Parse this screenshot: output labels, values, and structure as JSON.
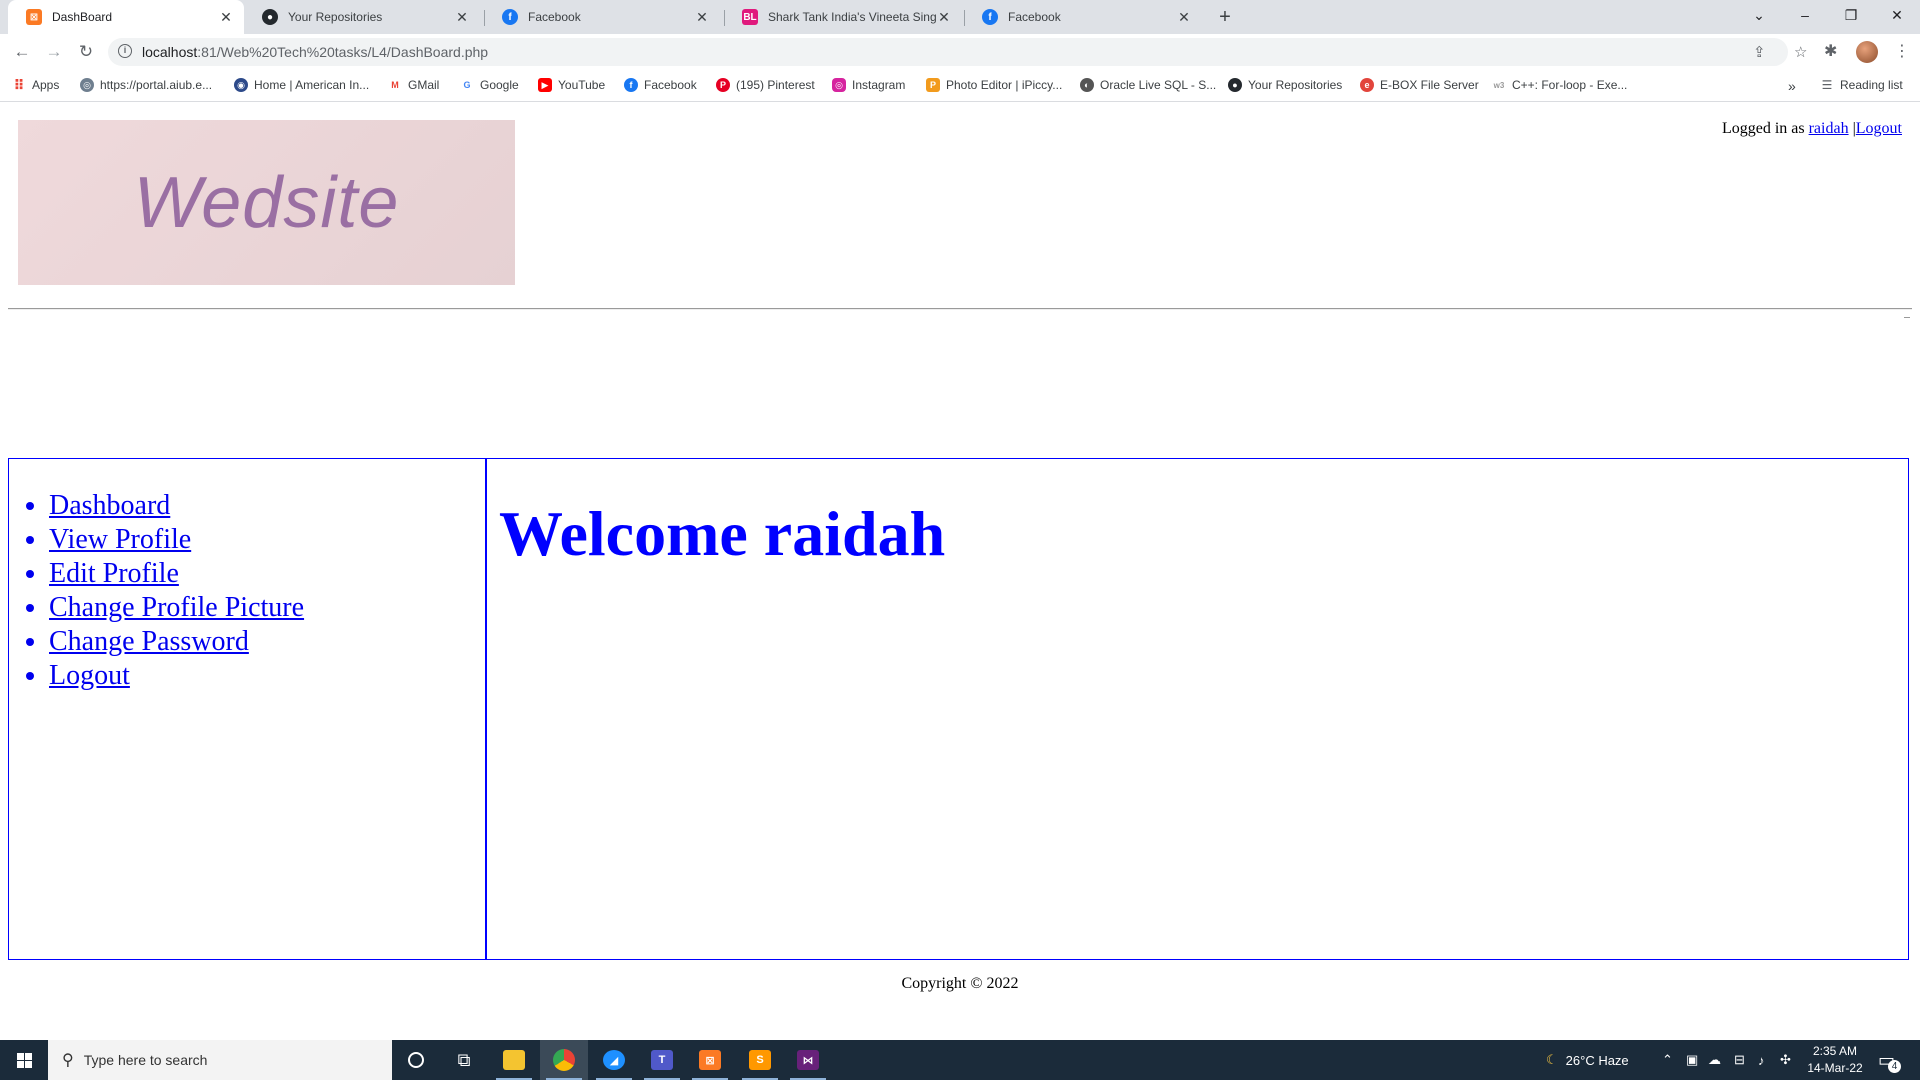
{
  "browser": {
    "tabs": [
      {
        "title": "DashBoard",
        "active": true,
        "icon": "xampp-icon"
      },
      {
        "title": "Your Repositories",
        "active": false,
        "icon": "github-icon"
      },
      {
        "title": "Facebook",
        "active": false,
        "icon": "facebook-icon"
      },
      {
        "title": "Shark Tank India's Vineeta Singh",
        "active": false,
        "icon": "bl-icon"
      },
      {
        "title": "Facebook",
        "active": false,
        "icon": "facebook-icon"
      }
    ],
    "url_host": "localhost",
    "url_rest": ":81/Web%20Tech%20tasks/L4/DashBoard.php",
    "bookmarks": [
      {
        "label": "Apps",
        "icon": "apps-grid-icon"
      },
      {
        "label": "https://portal.aiub.e...",
        "icon": "globe-icon"
      },
      {
        "label": "Home | American In...",
        "icon": "aiub-icon"
      },
      {
        "label": "GMail",
        "icon": "gmail-icon"
      },
      {
        "label": "Google",
        "icon": "google-icon"
      },
      {
        "label": "YouTube",
        "icon": "youtube-icon"
      },
      {
        "label": "Facebook",
        "icon": "facebook-icon"
      },
      {
        "label": "(195) Pinterest",
        "icon": "pinterest-icon"
      },
      {
        "label": "Instagram",
        "icon": "instagram-icon"
      },
      {
        "label": "Photo Editor | iPiccy...",
        "icon": "ipiccy-icon"
      },
      {
        "label": "Oracle Live SQL - S...",
        "icon": "oracle-icon"
      },
      {
        "label": "Your Repositories",
        "icon": "github-icon"
      },
      {
        "label": "E-BOX File Server",
        "icon": "ebox-icon"
      },
      {
        "label": "C++: For-loop - Exe...",
        "icon": "w3-icon"
      }
    ],
    "reading_list": "Reading list"
  },
  "page": {
    "logo_text": "Wedsite",
    "logged_in_prefix": "Logged in as ",
    "username": "raidah",
    "separator": "|",
    "logout_link": "Logout",
    "menu": [
      "Dashboard",
      "View Profile",
      "Edit Profile",
      "Change Profile Picture",
      "Change Password",
      "Logout"
    ],
    "welcome": "Welcome raidah",
    "footer": "Copyright © 2022"
  },
  "taskbar": {
    "search_placeholder": "Type here to search",
    "weather": "26°C  Haze",
    "time": "2:35 AM",
    "date": "14-Mar-22",
    "notifications": "4"
  }
}
